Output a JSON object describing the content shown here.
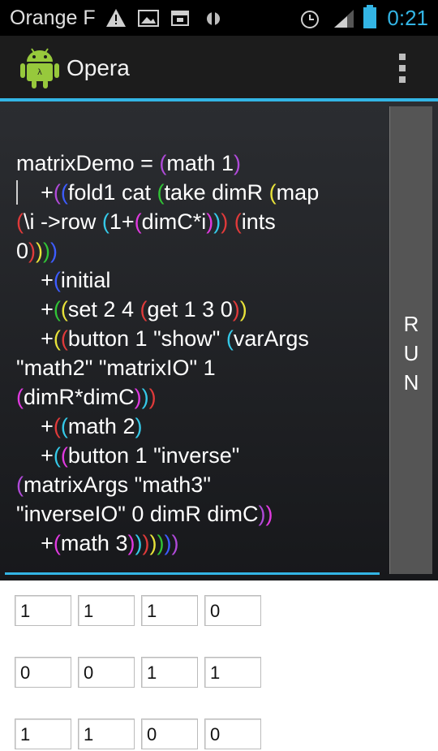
{
  "status_bar": {
    "carrier": "Orange F",
    "time": "0:21"
  },
  "app": {
    "title": "Opera"
  },
  "code_lines": [
    "matrixDemo = (math 1)",
    "    +((fold1 cat (take dimR (map",
    "(\\i ->row (1+(dimC*i))) (ints",
    "0))))",
    "    +(initial",
    "    +((set 2 4 (get 1 3 0))",
    "    +((button 1 \"show\" (varArgs",
    "\"math2\" \"matrixIO\" 1",
    "(dimR*dimC)))",
    "    +((math 2)",
    "    +((button 1 \"inverse\"",
    "(matrixArgs \"math3\"",
    "\"inverseIO\" 0 dimR dimC))",
    "    +(math 3)))))))"
  ],
  "run_button": {
    "letters": [
      "R",
      "U",
      "N"
    ]
  },
  "matrix": {
    "rows": [
      [
        "1",
        "1",
        "1",
        "0"
      ],
      [
        "0",
        "0",
        "1",
        "1"
      ],
      [
        "1",
        "1",
        "0",
        "0"
      ]
    ]
  }
}
